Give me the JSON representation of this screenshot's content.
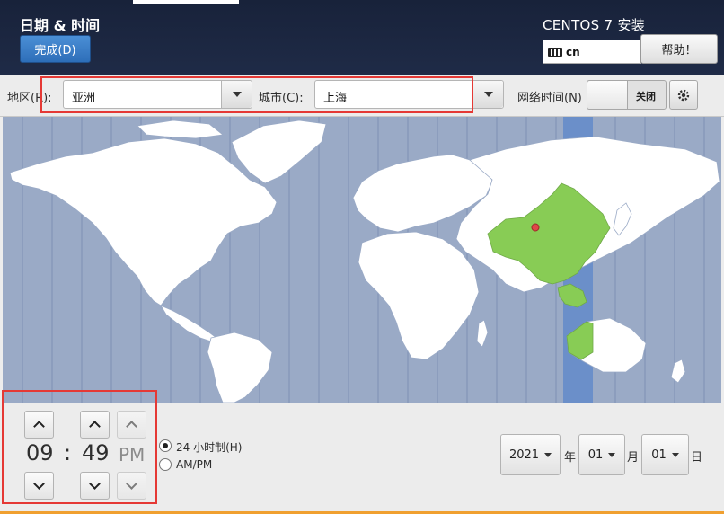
{
  "header": {
    "title": "日期 & 时间",
    "done_label": "完成(D)",
    "product": "CENTOS 7 安装",
    "keyboard_layout": "cn",
    "help_label": "帮助！"
  },
  "toolbar": {
    "region_label": "地区(R):",
    "region_value": "亚洲",
    "city_label": "城市(C):",
    "city_value": "上海",
    "network_time_label": "网络时间(N)",
    "network_time_state": "关闭"
  },
  "map": {
    "ocean_color": "#9aaac6",
    "land_color": "#ffffff",
    "selected_zone_color": "#88cc55",
    "selected_strip_color": "#6b8fc9",
    "pin_color": "#e04848"
  },
  "time": {
    "hour": "09",
    "separator": ":",
    "minute": "49",
    "ampm": "PM",
    "format_24h_label": "24 小时制(H)",
    "format_ampm_label": "AM/PM",
    "selected_format": "24h"
  },
  "date": {
    "year": "2021",
    "year_unit": "年",
    "month": "01",
    "month_unit": "月",
    "day": "01",
    "day_unit": "日"
  }
}
